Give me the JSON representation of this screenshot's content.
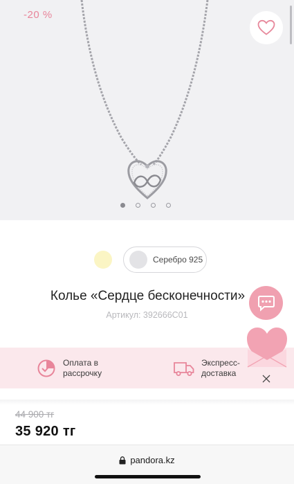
{
  "gallery": {
    "discount_badge": "-20 %",
    "favorite_icon": "heart-outline-icon",
    "image_subject": "necklace-image",
    "dots_total": 4,
    "active_dot": 1
  },
  "variants": {
    "gold_swatch_color": "#fbf5c4",
    "silver_label": "Серебро 925"
  },
  "product": {
    "title": "Колье «Сердце бесконечности»",
    "sku": "Артикул: 392666C01"
  },
  "floating": {
    "chat_icon": "chat-bubble-icon",
    "promo_icon": "heart-envelope-icon",
    "close_icon": "close-icon"
  },
  "benefits": [
    {
      "icon": "installment-icon",
      "line1": "Оплата в",
      "line2": "рассрочку"
    },
    {
      "icon": "delivery-truck-icon",
      "line1": "Экспресс-",
      "line2": "доставка"
    }
  ],
  "pricing": {
    "old_price": "44 900 тг",
    "price": "35 920 тг"
  },
  "browser": {
    "url": "pandora.kz"
  },
  "colors": {
    "accent_pink": "#f0a0b0",
    "discount_pink": "#e8859a",
    "benefits_bg": "#fbe8ec"
  }
}
